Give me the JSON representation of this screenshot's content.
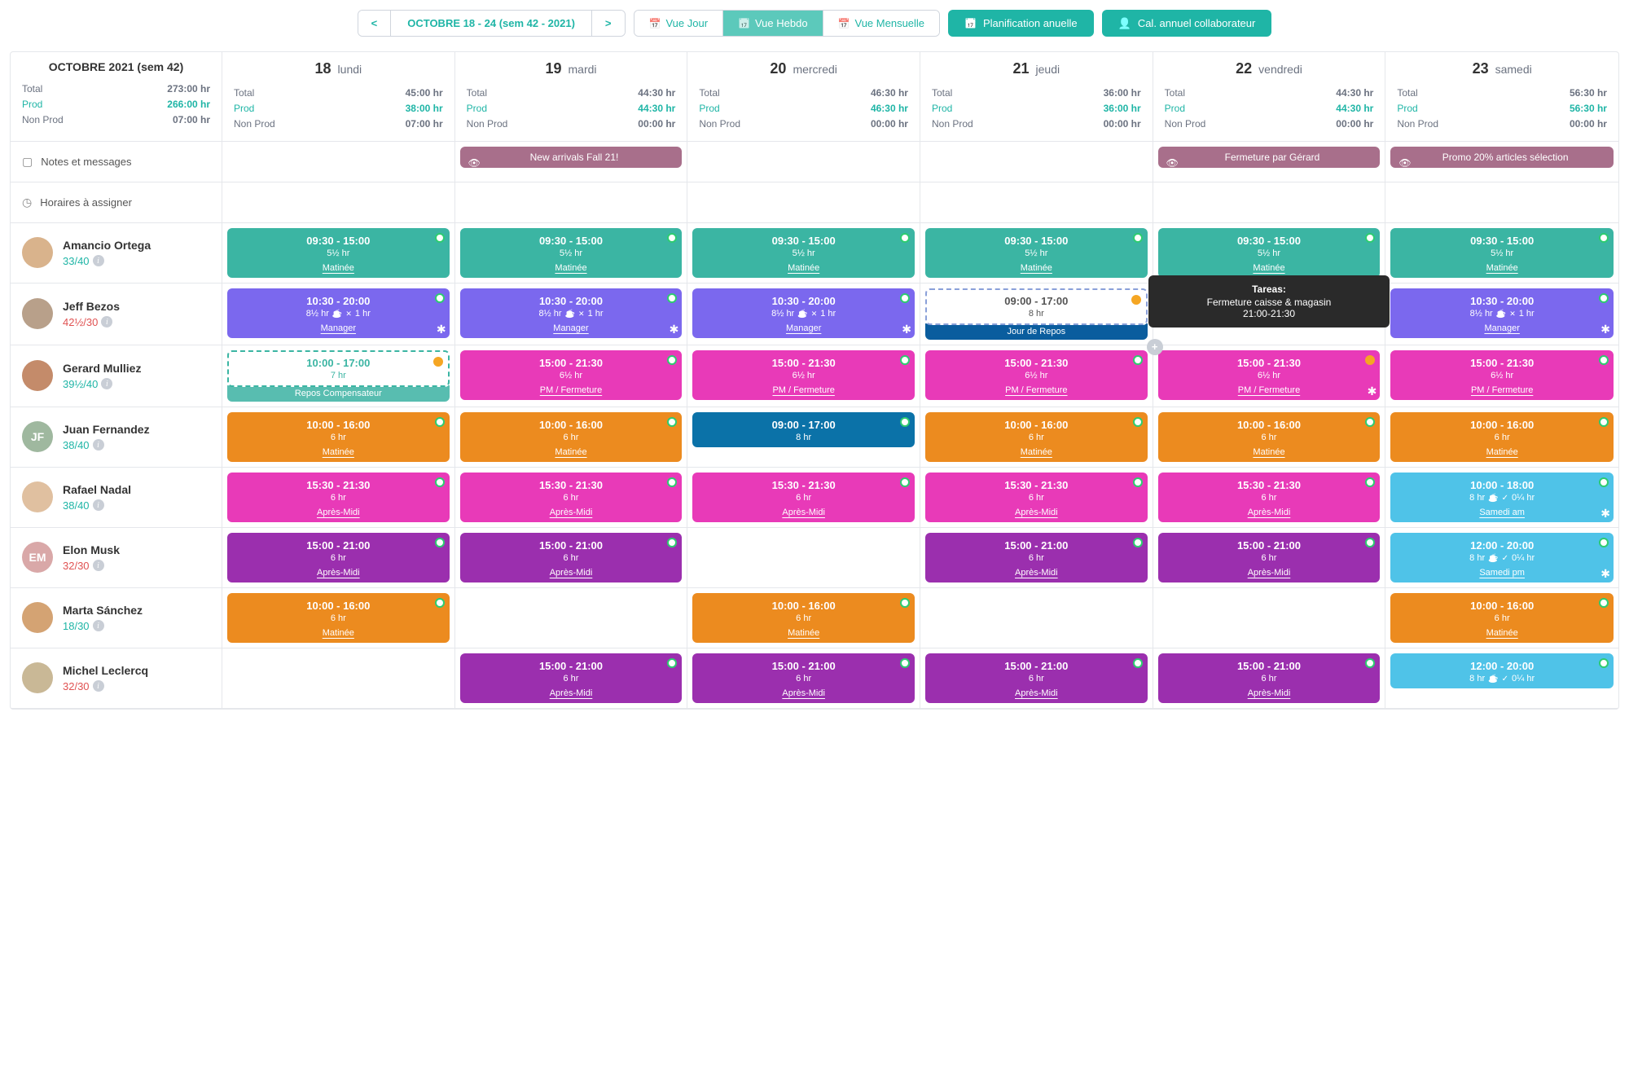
{
  "toolbar": {
    "date_range": "OCTOBRE 18 - 24 (sem 42 - 2021)",
    "view_day": "Vue Jour",
    "view_week": "Vue Hebdo",
    "view_month": "Vue Mensuelle",
    "annual_plan": "Planification anuelle",
    "annual_cal": "Cal. annuel collaborateur"
  },
  "week": {
    "title": "OCTOBRE 2021 (sem 42)",
    "total_label": "Total",
    "total_value": "273:00 hr",
    "prod_label": "Prod",
    "prod_value": "266:00 hr",
    "nonprod_label": "Non Prod",
    "nonprod_value": "07:00 hr"
  },
  "days": [
    {
      "num": "18",
      "name": "lundi",
      "total": "45:00 hr",
      "prod": "38:00 hr",
      "nonprod": "07:00 hr"
    },
    {
      "num": "19",
      "name": "mardi",
      "total": "44:30 hr",
      "prod": "44:30 hr",
      "nonprod": "00:00 hr"
    },
    {
      "num": "20",
      "name": "mercredi",
      "total": "46:30 hr",
      "prod": "46:30 hr",
      "nonprod": "00:00 hr"
    },
    {
      "num": "21",
      "name": "jeudi",
      "total": "36:00 hr",
      "prod": "36:00 hr",
      "nonprod": "00:00 hr"
    },
    {
      "num": "22",
      "name": "vendredi",
      "total": "44:30 hr",
      "prod": "44:30 hr",
      "nonprod": "00:00 hr"
    },
    {
      "num": "23",
      "name": "samedi",
      "total": "56:30 hr",
      "prod": "56:30 hr",
      "nonprod": "00:00 hr"
    }
  ],
  "rows": {
    "notes_label": "Notes et messages",
    "assign_label": "Horaires à assigner",
    "notes": {
      "d19": "New arrivals Fall 21!",
      "d22": "Fermeture par Gérard",
      "d23": "Promo 20% articles sélection"
    }
  },
  "tooltip": {
    "title": "Tareas:",
    "line1": "Fermeture caisse & magasin",
    "line2": "21:00-21:30"
  },
  "emp": [
    {
      "name": "Amancio Ortega",
      "hours": "33/40",
      "avatar_bg": "#d9b38c",
      "initials": "",
      "over": false
    },
    {
      "name": "Jeff Bezos",
      "hours": "42½/30",
      "avatar_bg": "#b8a08a",
      "initials": "",
      "over": true
    },
    {
      "name": "Gerard Mulliez",
      "hours": "39½/40",
      "avatar_bg": "#c48b6a",
      "initials": "",
      "over": false
    },
    {
      "name": "Juan Fernandez",
      "hours": "38/40",
      "avatar_bg": "#9fb89f",
      "initials": "JF",
      "over": false
    },
    {
      "name": "Rafael Nadal",
      "hours": "38/40",
      "avatar_bg": "#e0c0a0",
      "initials": "",
      "over": false
    },
    {
      "name": "Elon Musk",
      "hours": "32/30",
      "avatar_bg": "#d9a8a8",
      "initials": "EM",
      "over": true
    },
    {
      "name": "Marta Sánchez",
      "hours": "18/30",
      "avatar_bg": "#d4a373",
      "initials": "",
      "over": false
    },
    {
      "name": "Michel Leclercq",
      "hours": "32/30",
      "avatar_bg": "#c9b896",
      "initials": "",
      "over": true
    }
  ],
  "shifts": {
    "amancio": {
      "time": "09:30 - 15:00",
      "dur": "5½ hr",
      "tag": "Matinée"
    },
    "jeff_std": {
      "time": "10:30 - 20:00",
      "dur": "8½ hr",
      "break": "1 hr",
      "tag": "Manager"
    },
    "jeff_thu": {
      "time": "09:00 - 17:00",
      "dur": "8 hr",
      "rest": "Jour de Repos"
    },
    "gerard_mon": {
      "time": "10:00 - 17:00",
      "dur": "7 hr",
      "rest": "Repos Compensateur"
    },
    "gerard_std": {
      "time": "15:00 - 21:30",
      "dur": "6½ hr",
      "tag": "PM / Fermeture"
    },
    "juan_std": {
      "time": "10:00 - 16:00",
      "dur": "6 hr",
      "tag": "Matinée"
    },
    "juan_wed": {
      "time": "09:00 - 17:00",
      "dur": "8 hr"
    },
    "rafael_std": {
      "time": "15:30 - 21:30",
      "dur": "6 hr",
      "tag": "Après-Midi"
    },
    "rafael_sat": {
      "time": "10:00 - 18:00",
      "dur": "8 hr",
      "br": "0¼ hr",
      "tag": "Samedi am"
    },
    "elon_std": {
      "time": "15:00 - 21:00",
      "dur": "6 hr",
      "tag": "Après-Midi"
    },
    "elon_sat": {
      "time": "12:00 - 20:00",
      "dur": "8 hr",
      "br": "0¼ hr",
      "tag": "Samedi pm"
    },
    "marta": {
      "time": "10:00 - 16:00",
      "dur": "6 hr",
      "tag": "Matinée"
    },
    "michel_std": {
      "time": "15:00 - 21:00",
      "dur": "6 hr",
      "tag": "Après-Midi"
    },
    "michel_sat": {
      "time": "12:00 - 20:00",
      "dur": "8 hr",
      "br": "0¼ hr"
    }
  }
}
